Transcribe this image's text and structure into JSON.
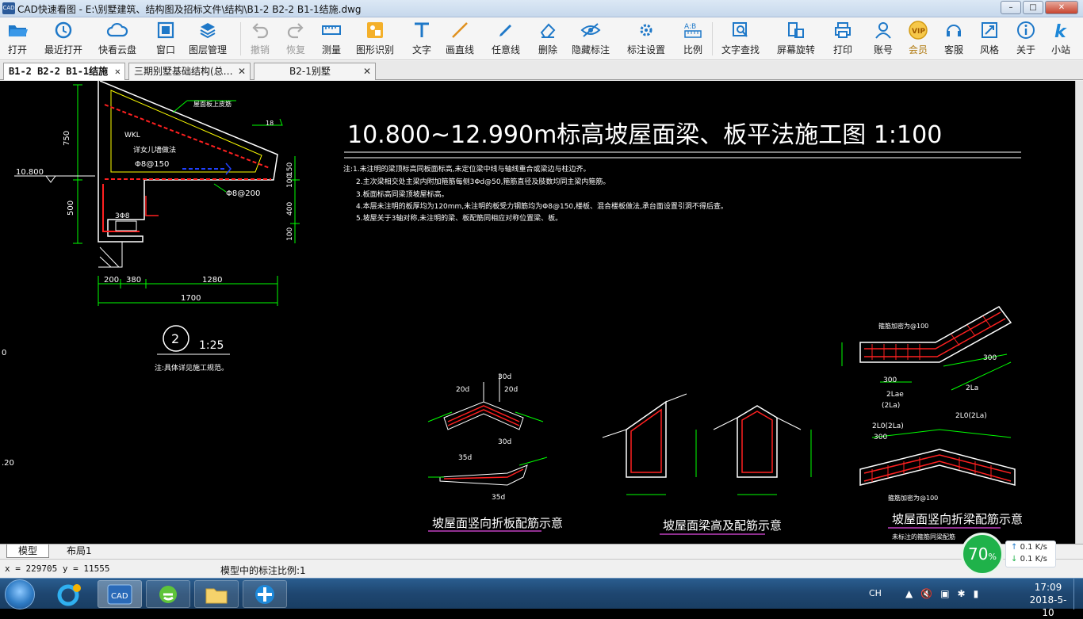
{
  "window": {
    "title": "CAD快速看图 - E:\\别墅建筑、结构图及招标文件\\结构\\B1-2 B2-2 B1-1结施.dwg",
    "app_icon_text": "CAD",
    "controls": [
      "–",
      "□",
      "✕"
    ]
  },
  "toolbar": {
    "items": [
      {
        "id": "open",
        "label": "打开",
        "icon": "folder-open-icon"
      },
      {
        "id": "recent",
        "label": "最近打开",
        "icon": "history-icon"
      },
      {
        "id": "cloud",
        "label": "快看云盘",
        "icon": "cloud-icon"
      },
      {
        "id": "window",
        "label": "窗口",
        "icon": "window-icon"
      },
      {
        "id": "layers",
        "label": "图层管理",
        "icon": "layers-icon"
      },
      {
        "id": "undo",
        "label": "撤销",
        "icon": "undo-icon",
        "disabled": true
      },
      {
        "id": "redo",
        "label": "恢复",
        "icon": "redo-icon",
        "disabled": true
      },
      {
        "id": "measure",
        "label": "测量",
        "icon": "ruler-icon"
      },
      {
        "id": "shape-recognize",
        "label": "图形识别",
        "icon": "shape-recognize-icon"
      },
      {
        "id": "text",
        "label": "文字",
        "icon": "text-icon"
      },
      {
        "id": "line",
        "label": "画直线",
        "icon": "line-icon"
      },
      {
        "id": "freehand",
        "label": "任意线",
        "icon": "pen-icon"
      },
      {
        "id": "delete",
        "label": "删除",
        "icon": "eraser-icon"
      },
      {
        "id": "hide-marks",
        "label": "隐藏标注",
        "icon": "eye-icon"
      },
      {
        "id": "mark-settings",
        "label": "标注设置",
        "icon": "gear-pen-icon"
      },
      {
        "id": "ratio",
        "label": "比例",
        "icon": "ratio-icon"
      },
      {
        "id": "text-search",
        "label": "文字查找",
        "icon": "text-search-icon"
      },
      {
        "id": "rotate",
        "label": "屏幕旋转",
        "icon": "rotate-screen-icon"
      },
      {
        "id": "print",
        "label": "打印",
        "icon": "printer-icon"
      },
      {
        "id": "account",
        "label": "账号",
        "icon": "user-icon"
      },
      {
        "id": "vip",
        "label": "会员",
        "icon": "vip-icon"
      },
      {
        "id": "support",
        "label": "客服",
        "icon": "headset-icon"
      },
      {
        "id": "style",
        "label": "风格",
        "icon": "style-icon"
      },
      {
        "id": "about",
        "label": "关于",
        "icon": "info-icon"
      },
      {
        "id": "site",
        "label": "小站",
        "icon": "k-logo-icon"
      }
    ]
  },
  "tabs": [
    {
      "label": "B1-2 B2-2 B1-1结施",
      "active": true
    },
    {
      "label": "三期别墅基础结构(总…",
      "active": false
    },
    {
      "label": "B2-1别墅",
      "active": false
    }
  ],
  "drawing": {
    "title": "10.800~12.990m标高坡屋面梁、板平法施工图 1:100",
    "notes": [
      "注:1.未注明的梁顶标高同板面标高,未定位梁中线与轴线重合或梁边与柱边齐。",
      "2.主次梁相交处主梁内附加箍筋每侧3Φd@50,箍筋直径及肢数均同主梁内箍筋。",
      "3.板面标高同梁顶坡屋标高。",
      "4.本层未注明的板厚均为120mm,未注明的板受力钢筋均为Φ8@150,楼板、混合楼板做法,承台面设置引洞不得后查。",
      "5.坡屋关于3轴对称,未注明的梁、板配筋同相应对称位置梁、板。"
    ],
    "detail": {
      "elevation": "10.800",
      "dims_vertical": [
        "750",
        "500",
        "150",
        "100",
        "400",
        "100"
      ],
      "dims_horizontal": [
        "200",
        "380",
        "1280",
        "1700"
      ],
      "labels": [
        "屋面板上皮筋",
        "WKL",
        "详女儿墙做法",
        "Φ8@150",
        "Φ8@200",
        "3Φ8"
      ],
      "slope": "18",
      "index_number": "2",
      "index_scale": "1:25",
      "index_note": "注:具体详见施工规范。"
    },
    "sketches": [
      {
        "caption": "坡屋面竖向折板配筋示意",
        "labels": [
          "30d",
          "20d",
          "20d",
          "30d",
          "35d",
          "35d"
        ]
      },
      {
        "caption": "坡屋面梁高及配筋示意",
        "labels": []
      },
      {
        "caption": "坡屋面竖向折梁配筋示意",
        "labels": [
          "箍筋加密为@100",
          "300",
          "300",
          "2Lae",
          "(2La)",
          "2La",
          "2L0(2La)",
          "2L0(2La)",
          "300",
          "箍筋加密为@100",
          "未标注的箍筋同梁配筋"
        ]
      }
    ],
    "left_edge_marks": [
      "0",
      ".20"
    ]
  },
  "layouts": [
    {
      "label": "模型",
      "active": true
    },
    {
      "label": "布局1",
      "active": false
    }
  ],
  "status": {
    "coordinates": "x = 229705  y = 11555",
    "annotation_scale": "模型中的标注比例:1"
  },
  "network": {
    "percent": "70",
    "percent_suffix": "%",
    "up": "0.1 K/s",
    "down": "0.1 K/s"
  },
  "taskbar": {
    "apps": [
      "start-orb",
      "360-browser",
      "cad-viewer",
      "ie-browser",
      "file-explorer",
      "feixin"
    ],
    "ime": "CH",
    "time": "17:09",
    "date": "2018-5-10"
  },
  "colors": {
    "cad_background": "#000000",
    "line_green": "#00ff00",
    "line_white": "#ffffff",
    "line_red": "#ff2020",
    "line_yellow": "#ffff00",
    "line_blue": "#2040ff",
    "caption_purple": "#c040c0",
    "network_green": "#1fb24a"
  }
}
